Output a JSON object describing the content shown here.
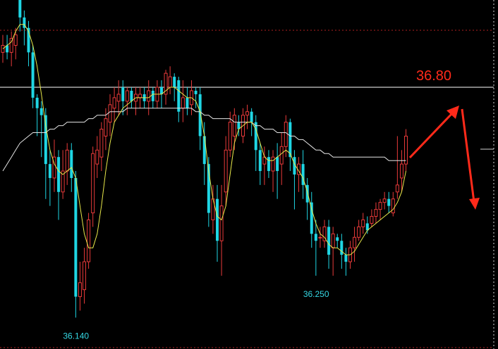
{
  "chart_data": {
    "type": "candlestick",
    "ylim": [
      36.05,
      37.05
    ],
    "colors": {
      "up": "#e83a3a",
      "down": "#1fd6e4",
      "ma_short": "#e8e84a",
      "ma_long": "#e6e6e6",
      "resistance": "#ffffff",
      "grid": "#b02020",
      "arrow": "#ff2a1a",
      "low_label": "#35d8e4",
      "target_label": "#ff2a1a"
    },
    "resistance_level": 36.8,
    "target_label": "36.80",
    "low_annotations": [
      {
        "index": 17,
        "text": "36.140"
      },
      {
        "index": 73,
        "text": "36.250"
      }
    ],
    "candles": [
      [
        36.9,
        36.92,
        36.87,
        36.95
      ],
      [
        36.92,
        36.9,
        36.88,
        36.95
      ],
      [
        36.9,
        36.94,
        36.86,
        36.96
      ],
      [
        36.92,
        36.95,
        36.88,
        36.97
      ],
      [
        37.08,
        37.0,
        36.96,
        37.1
      ],
      [
        37.0,
        36.97,
        36.92,
        37.02
      ],
      [
        36.97,
        36.9,
        36.86,
        36.99
      ],
      [
        36.9,
        36.77,
        36.74,
        36.92
      ],
      [
        36.77,
        36.74,
        36.66,
        36.78
      ],
      [
        36.74,
        36.72,
        36.6,
        36.76
      ],
      [
        36.72,
        36.58,
        36.48,
        36.74
      ],
      [
        36.58,
        36.54,
        36.46,
        36.62
      ],
      [
        36.54,
        36.6,
        36.5,
        36.65
      ],
      [
        36.6,
        36.5,
        36.42,
        36.62
      ],
      [
        36.5,
        36.56,
        36.48,
        36.62
      ],
      [
        36.56,
        36.62,
        36.52,
        36.64
      ],
      [
        36.62,
        36.54,
        36.5,
        36.64
      ],
      [
        36.54,
        36.2,
        36.14,
        36.56
      ],
      [
        36.2,
        36.24,
        36.16,
        36.3
      ],
      [
        36.22,
        36.3,
        36.18,
        36.34
      ],
      [
        36.3,
        36.42,
        36.28,
        36.44
      ],
      [
        36.44,
        36.61,
        36.4,
        36.63
      ],
      [
        36.58,
        36.62,
        36.54,
        36.66
      ],
      [
        36.6,
        36.68,
        36.56,
        36.7
      ],
      [
        36.66,
        36.71,
        36.62,
        36.74
      ],
      [
        36.7,
        36.75,
        36.66,
        36.78
      ],
      [
        36.74,
        36.77,
        36.7,
        36.8
      ],
      [
        36.76,
        36.78,
        36.72,
        36.82
      ],
      [
        36.8,
        36.76,
        36.72,
        36.82
      ],
      [
        36.76,
        36.79,
        36.72,
        36.8
      ],
      [
        36.79,
        36.76,
        36.74,
        36.8
      ],
      [
        36.76,
        36.78,
        36.72,
        36.8
      ],
      [
        36.77,
        36.78,
        36.74,
        36.8
      ],
      [
        36.78,
        36.76,
        36.74,
        36.8
      ],
      [
        36.76,
        36.79,
        36.72,
        36.82
      ],
      [
        36.79,
        36.76,
        36.74,
        36.8
      ],
      [
        36.76,
        36.8,
        36.74,
        36.82
      ],
      [
        36.8,
        36.78,
        36.74,
        36.82
      ],
      [
        36.78,
        36.84,
        36.75,
        36.85
      ],
      [
        36.8,
        36.83,
        36.78,
        36.86
      ],
      [
        36.83,
        36.8,
        36.76,
        36.84
      ],
      [
        36.82,
        36.73,
        36.7,
        36.83
      ],
      [
        36.74,
        36.77,
        36.7,
        36.82
      ],
      [
        36.77,
        36.74,
        36.72,
        36.8
      ],
      [
        36.75,
        36.79,
        36.72,
        36.82
      ],
      [
        36.79,
        36.78,
        36.74,
        36.8
      ],
      [
        36.78,
        36.66,
        36.62,
        36.8
      ],
      [
        36.66,
        36.58,
        36.52,
        36.7
      ],
      [
        36.58,
        36.44,
        36.4,
        36.6
      ],
      [
        36.42,
        36.48,
        36.38,
        36.52
      ],
      [
        36.48,
        36.36,
        36.3,
        36.52
      ],
      [
        36.36,
        36.46,
        36.26,
        36.52
      ],
      [
        36.5,
        36.62,
        36.46,
        36.66
      ],
      [
        36.62,
        36.7,
        36.6,
        36.73
      ],
      [
        36.66,
        36.72,
        36.62,
        36.74
      ],
      [
        36.7,
        36.68,
        36.66,
        36.72
      ],
      [
        36.66,
        36.72,
        36.64,
        36.74
      ],
      [
        36.72,
        36.73,
        36.68,
        36.75
      ],
      [
        36.73,
        36.7,
        36.66,
        36.74
      ],
      [
        36.7,
        36.62,
        36.56,
        36.72
      ],
      [
        36.62,
        36.56,
        36.52,
        36.64
      ],
      [
        36.58,
        36.6,
        36.52,
        36.63
      ],
      [
        36.6,
        36.56,
        36.54,
        36.62
      ],
      [
        36.56,
        36.6,
        36.5,
        36.62
      ],
      [
        36.6,
        36.56,
        36.48,
        36.64
      ],
      [
        36.58,
        36.63,
        36.52,
        36.67
      ],
      [
        36.63,
        36.7,
        36.6,
        36.72
      ],
      [
        36.7,
        36.6,
        36.56,
        36.71
      ],
      [
        36.6,
        36.55,
        36.45,
        36.62
      ],
      [
        36.55,
        36.58,
        36.5,
        36.6
      ],
      [
        36.58,
        36.52,
        36.48,
        36.62
      ],
      [
        36.52,
        36.47,
        36.42,
        36.54
      ],
      [
        36.47,
        36.38,
        36.34,
        36.5
      ],
      [
        36.38,
        36.36,
        36.26,
        36.42
      ],
      [
        36.37,
        36.37,
        36.34,
        36.4
      ],
      [
        36.36,
        36.4,
        36.34,
        36.42
      ],
      [
        36.4,
        36.32,
        36.28,
        36.42
      ],
      [
        36.34,
        36.38,
        36.26,
        36.4
      ],
      [
        36.37,
        36.36,
        36.34,
        36.38
      ],
      [
        36.36,
        36.32,
        36.28,
        36.38
      ],
      [
        36.32,
        36.3,
        36.26,
        36.34
      ],
      [
        36.3,
        36.34,
        36.28,
        36.36
      ],
      [
        36.34,
        36.37,
        36.3,
        36.4
      ],
      [
        36.37,
        36.4,
        36.36,
        36.42
      ],
      [
        36.4,
        36.42,
        36.38,
        36.44
      ],
      [
        36.41,
        36.39,
        36.38,
        36.43
      ],
      [
        36.41,
        36.43,
        36.4,
        36.45
      ],
      [
        36.43,
        36.45,
        36.41,
        36.47
      ],
      [
        36.45,
        36.47,
        36.42,
        36.48
      ],
      [
        36.47,
        36.48,
        36.45,
        36.5
      ],
      [
        36.48,
        36.46,
        36.44,
        36.5
      ],
      [
        36.44,
        36.48,
        36.43,
        36.5
      ],
      [
        36.5,
        36.52,
        36.48,
        36.66
      ],
      [
        36.54,
        36.58,
        36.5,
        36.62
      ],
      [
        36.58,
        36.66,
        36.56,
        36.68
      ]
    ],
    "ma_short": [
      36.91,
      36.92,
      36.93,
      36.96,
      36.98,
      36.98,
      36.96,
      36.92,
      36.86,
      36.78,
      36.69,
      36.62,
      36.58,
      36.56,
      36.55,
      36.56,
      36.57,
      36.54,
      36.46,
      36.38,
      36.34,
      36.34,
      36.38,
      36.46,
      36.56,
      36.64,
      36.7,
      36.72,
      36.74,
      36.75,
      36.76,
      36.77,
      36.77,
      36.77,
      36.77,
      36.78,
      36.78,
      36.78,
      36.79,
      36.8,
      36.8,
      36.79,
      36.78,
      36.77,
      36.77,
      36.76,
      36.73,
      36.66,
      36.56,
      36.48,
      36.43,
      36.42,
      36.46,
      36.55,
      36.64,
      36.68,
      36.69,
      36.7,
      36.7,
      36.68,
      36.64,
      36.6,
      36.59,
      36.59,
      36.6,
      36.61,
      36.62,
      36.61,
      36.58,
      36.56,
      36.54,
      36.5,
      36.45,
      36.41,
      36.38,
      36.37,
      36.35,
      36.34,
      36.34,
      36.33,
      36.32,
      36.32,
      36.33,
      36.35,
      36.37,
      36.39,
      36.4,
      36.41,
      36.42,
      36.43,
      36.44,
      36.45,
      36.47,
      36.5,
      36.56
    ],
    "ma_long": [
      36.56,
      36.58,
      36.6,
      36.62,
      36.64,
      36.65,
      36.66,
      36.67,
      36.67,
      36.67,
      36.67,
      36.68,
      36.68,
      36.69,
      36.69,
      36.7,
      36.7,
      36.7,
      36.7,
      36.7,
      36.71,
      36.71,
      36.72,
      36.72,
      36.72,
      36.73,
      36.73,
      36.73,
      36.73,
      36.74,
      36.74,
      36.74,
      36.74,
      36.74,
      36.74,
      36.74,
      36.74,
      36.74,
      36.74,
      36.74,
      36.74,
      36.74,
      36.74,
      36.74,
      36.74,
      36.73,
      36.73,
      36.72,
      36.72,
      36.71,
      36.71,
      36.71,
      36.71,
      36.71,
      36.7,
      36.7,
      36.7,
      36.7,
      36.7,
      36.69,
      36.69,
      36.68,
      36.68,
      36.68,
      36.67,
      36.67,
      36.67,
      36.66,
      36.66,
      36.65,
      36.65,
      36.64,
      36.63,
      36.62,
      36.62,
      36.61,
      36.61,
      36.6,
      36.6,
      36.6,
      36.6,
      36.6,
      36.6,
      36.6,
      36.6,
      36.6,
      36.6,
      36.6,
      36.6,
      36.6,
      36.59,
      36.59,
      36.59,
      36.59,
      36.59
    ]
  }
}
